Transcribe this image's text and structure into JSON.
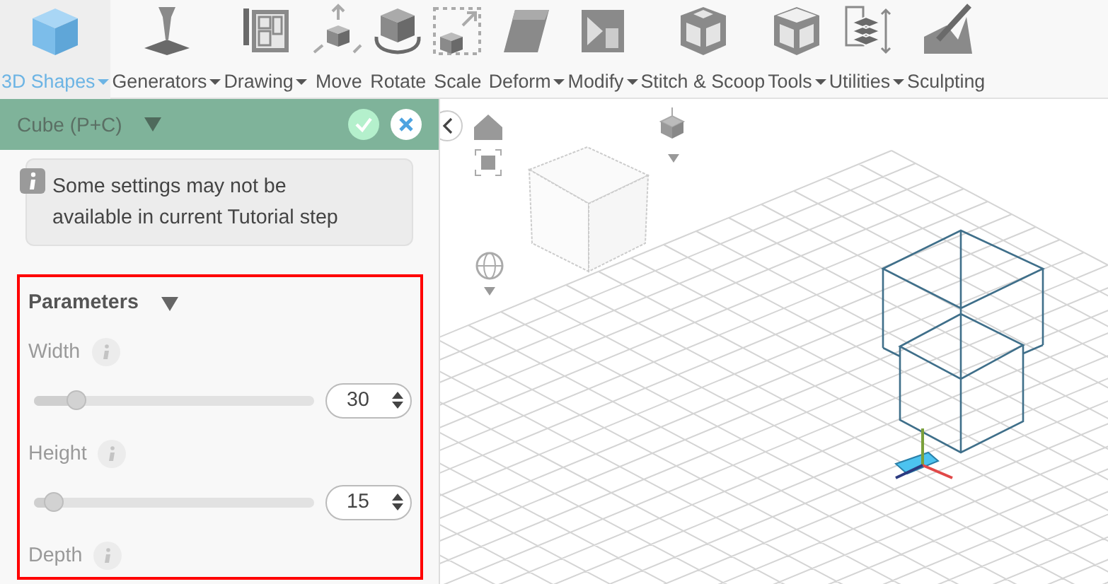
{
  "toolbar": {
    "items": [
      {
        "label": "3D Shapes",
        "dropdown": true,
        "selected": true
      },
      {
        "label": "Generators",
        "dropdown": true,
        "selected": false
      },
      {
        "label": "Drawing",
        "dropdown": true,
        "selected": false
      },
      {
        "label": "Move",
        "dropdown": false,
        "selected": false
      },
      {
        "label": "Rotate",
        "dropdown": false,
        "selected": false
      },
      {
        "label": "Scale",
        "dropdown": false,
        "selected": false
      },
      {
        "label": "Deform",
        "dropdown": true,
        "selected": false
      },
      {
        "label": "Modify",
        "dropdown": true,
        "selected": false
      },
      {
        "label": "Stitch & Scoop",
        "dropdown": false,
        "selected": false
      },
      {
        "label": "Tools",
        "dropdown": true,
        "selected": false
      },
      {
        "label": "Utilities",
        "dropdown": true,
        "selected": false
      },
      {
        "label": "Sculpting",
        "dropdown": false,
        "selected": false
      }
    ]
  },
  "panel": {
    "title": "Cube (P+C)",
    "notice": "Some settings may not be available in current Tutorial step",
    "section": {
      "title": "Parameters",
      "expanded": true,
      "params": [
        {
          "label": "Width",
          "level": 0.15,
          "value": "30"
        },
        {
          "label": "Height",
          "level": 0.07,
          "value": "15"
        },
        {
          "label": "Depth"
        }
      ]
    }
  }
}
